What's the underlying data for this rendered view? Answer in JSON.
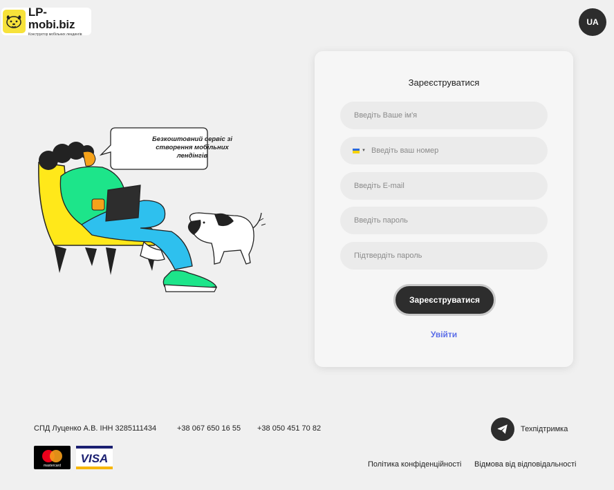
{
  "header": {
    "logo_name": "LP-mobi.biz",
    "logo_tagline": "Конструктор мобільних лендингів",
    "lang_label": "UA"
  },
  "illustration": {
    "bubble_text": "Безкоштовний сервіс зі створення мобільних лендінгів"
  },
  "form": {
    "title": "Зареєструватися",
    "name_placeholder": "Введіть Ваше ім'я",
    "phone_placeholder": "Введіть ваш номер",
    "email_placeholder": "Введіть E-mail",
    "password_placeholder": "Введіть пароль",
    "confirm_placeholder": "Підтвердіть пароль",
    "submit_label": "Зареєструватися",
    "login_label": "Увійти"
  },
  "footer": {
    "company": "СПД Луценко А.В. ІНН 3285111434",
    "phone1": "+38 067 650 16 55",
    "phone2": "+38 050 451 70 82",
    "support_label": "Техпідтримка",
    "privacy_label": "Політика конфіденційності",
    "disclaimer_label": "Відмова від відповідальності",
    "mastercard_label": "mastercard",
    "visa_label": "VISA"
  },
  "colors": {
    "accent_dark": "#2d2d2d",
    "link_blue": "#5b6ee8",
    "logo_yellow": "#f7e23a",
    "chair_yellow": "#ffe81a",
    "shirt_green": "#1de58a",
    "pants_blue": "#2ec0ee"
  },
  "icons": {
    "logo": "dog-face-icon",
    "support": "telegram-plane-icon",
    "flag": "ukraine-flag-icon"
  }
}
